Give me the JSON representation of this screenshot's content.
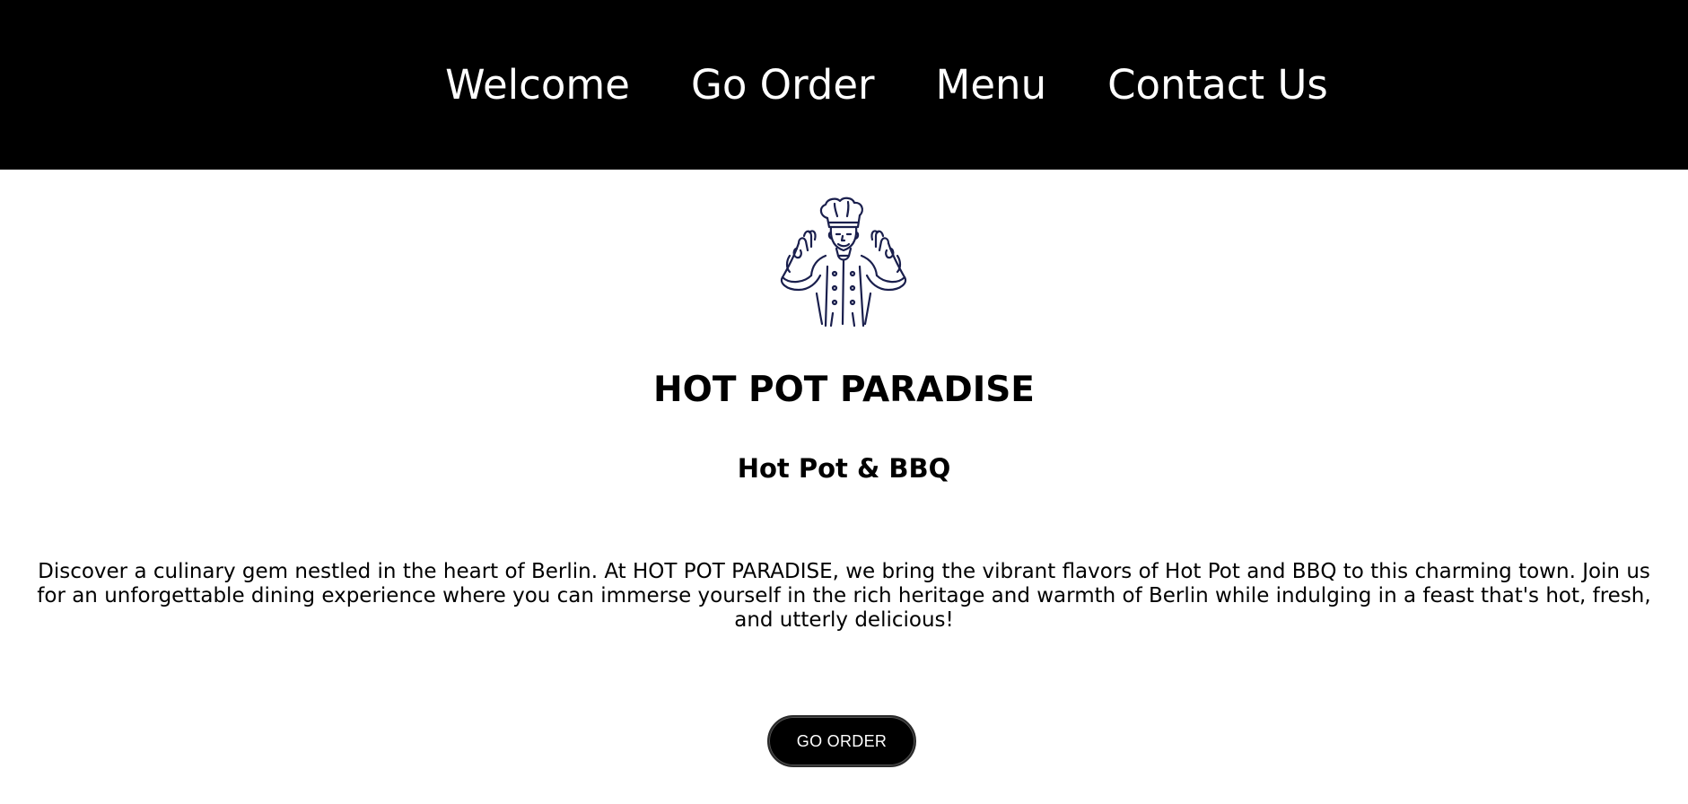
{
  "nav": {
    "items": [
      {
        "label": "Welcome"
      },
      {
        "label": "Go Order"
      },
      {
        "label": "Menu"
      },
      {
        "label": "Contact Us"
      }
    ]
  },
  "logo": {
    "icon": "chef-icon",
    "color": "#1a1f4d"
  },
  "hero": {
    "title": "HOT POT PARADISE",
    "subtitle": "Hot Pot & BBQ",
    "description": "Discover a culinary gem nestled in the heart of Berlin. At HOT POT PARADISE, we bring the vibrant flavors of Hot Pot and BBQ to this charming town. Join us for an unforgettable dining experience where you can immerse yourself in the rich heritage and warmth of Berlin while indulging in a feast that's hot, fresh, and utterly delicious!",
    "cta_label": "GO ORDER"
  },
  "colors": {
    "nav_background": "#000000",
    "nav_text": "#ffffff",
    "button_background": "#000000",
    "button_text": "#ffffff"
  }
}
